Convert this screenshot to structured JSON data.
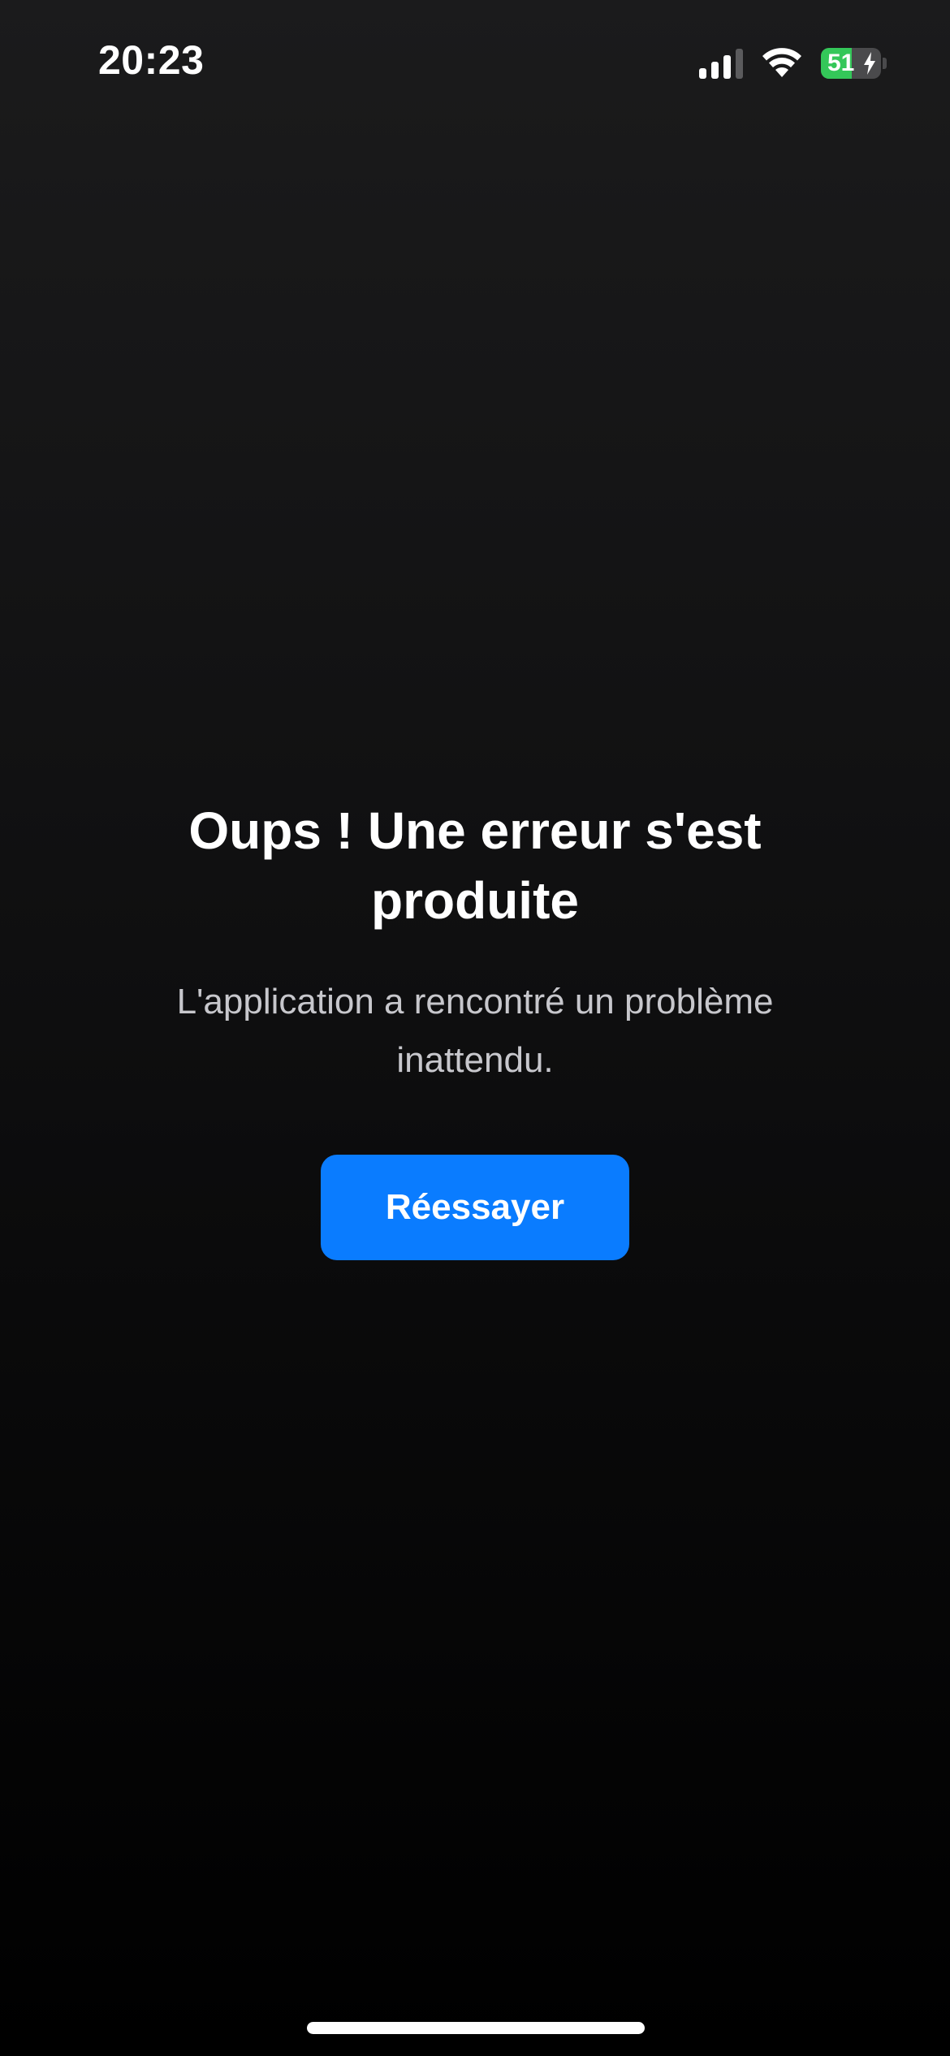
{
  "status_bar": {
    "time": "20:23",
    "signal_bars_active": 3,
    "signal_bars_total": 4,
    "wifi_icon": "wifi-icon",
    "battery": {
      "level_text": "51",
      "level_percent": 51,
      "charging": true,
      "fill_color": "#34c759"
    }
  },
  "error": {
    "title": "Oups ! Une erreur s'est produite",
    "message": "L'application a rencontré un problème inattendu.",
    "retry_label": "Réessayer"
  },
  "colors": {
    "accent": "#0a7cff",
    "background_top": "#1b1b1c",
    "background_bottom": "#000000",
    "secondary_text": "#c7c7cc"
  }
}
